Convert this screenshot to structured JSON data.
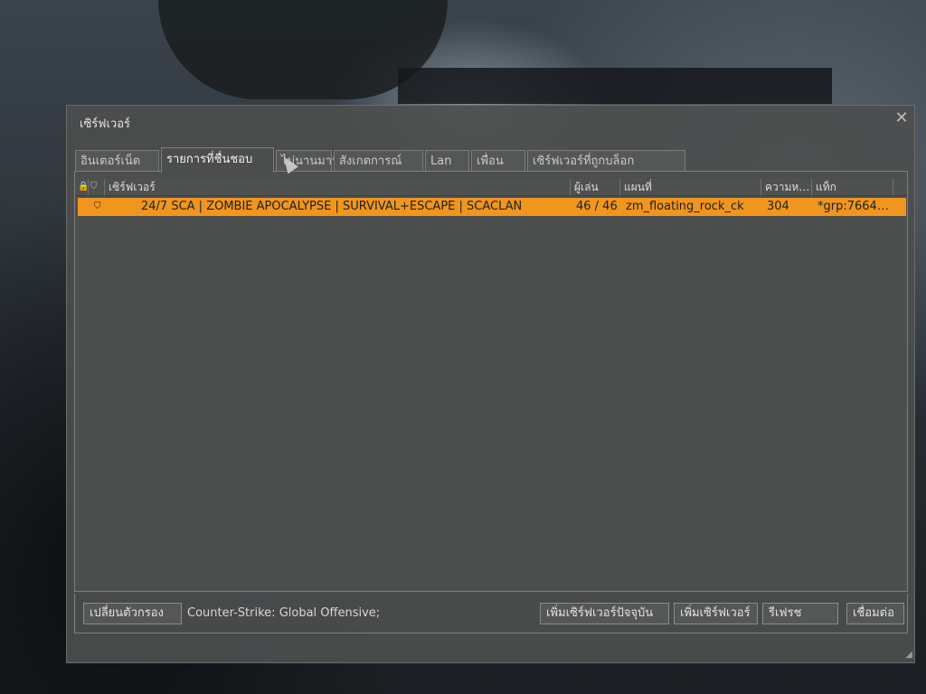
{
  "window": {
    "title": "เซิร์ฟเวอร์",
    "close_glyph": "✕"
  },
  "tabs": [
    {
      "label": "อินเตอร์เน็ต"
    },
    {
      "label": "รายการที่ชื่นชอบ",
      "active": true
    },
    {
      "label": "ไม่นานมานี้"
    },
    {
      "label": "สังเกตการณ์"
    },
    {
      "label": "Lan"
    },
    {
      "label": "เพื่อน"
    },
    {
      "label": "เซิร์ฟเวอร์ที่ถูกบล็อก"
    }
  ],
  "columns": {
    "lock_icon": "🔒",
    "secure_icon": "⛉",
    "server": "เซิร์ฟเวอร์",
    "players": "ผู้เล่น",
    "map": "แผนที่",
    "latency": "ความหน่วง",
    "tags": "แท็ก"
  },
  "servers": [
    {
      "secure_icon": "⛉",
      "name": "24/7 SCA | ZOMBIE APOCALYPSE | SURVIVAL+ESCAPE | SCACLAN",
      "players": "46 / 46",
      "map": "zm_floating_rock_ck",
      "latency": "304",
      "tags": "*grp:7664…"
    }
  ],
  "bottom_bar": {
    "change_filter_label": "เปลี่ยนตัวกรอง",
    "game_filter_text": "Counter-Strike: Global Offensive;",
    "add_current_server_label": "เพิ่มเซิร์ฟเวอร์ปัจจุบัน",
    "add_server_label": "เพิ่มเซิร์ฟเวอร์",
    "refresh_label": "รีเฟรช",
    "connect_label": "เชื่อมต่อ"
  },
  "colors": {
    "selected_row": "#f0961e",
    "window_bg": "#4c4e4e"
  }
}
